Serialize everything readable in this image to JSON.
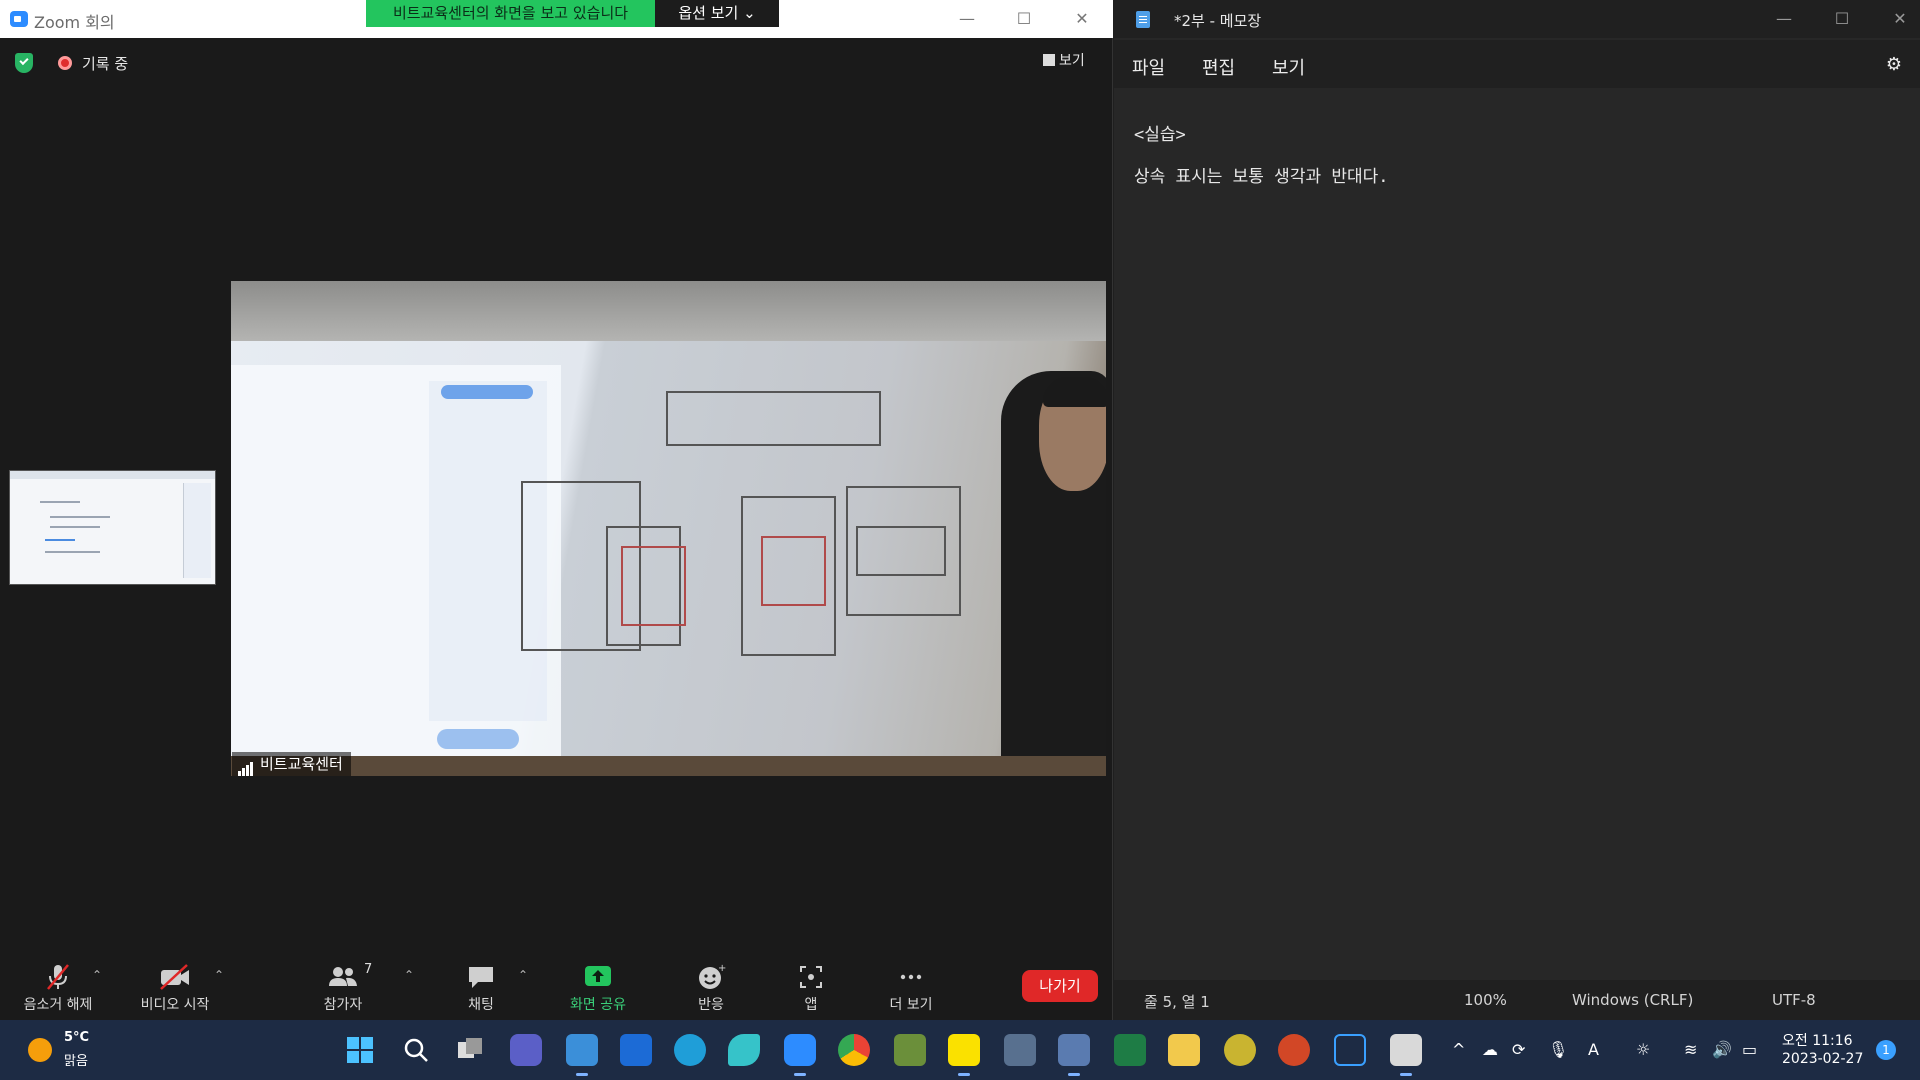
{
  "zoom": {
    "title": "Zoom 회의",
    "share_banner": "비트교육센터의 화면을 보고 있습니다",
    "options_label": "옵션 보기 ⌄",
    "recording_label": "기록 중",
    "view_label": "보기",
    "participant_name": "비트교육센터",
    "toolbar": {
      "audio": "음소거 해제",
      "video": "비디오 시작",
      "participants": "참가자",
      "participants_count": "7",
      "chat": "채팅",
      "share": "화면 공유",
      "reactions": "반응",
      "apps": "앱",
      "more": "더 보기",
      "leave": "나가기"
    }
  },
  "notepad": {
    "title": "*2부 - 메모장",
    "menu": [
      "파일",
      "편집",
      "보기"
    ],
    "lines": [
      "<실습>",
      "상속 표시는 보통 생각과 반대다."
    ],
    "status": {
      "position": "줄 5, 열 1",
      "zoom": "100%",
      "line_ending": "Windows (CRLF)",
      "encoding": "UTF-8"
    }
  },
  "taskbar": {
    "weather_temp": "5°C",
    "weather_desc": "맑음",
    "time": "오전 11:16",
    "date": "2023-02-27",
    "notification_count": "1",
    "apps": [
      "windows-start",
      "search",
      "task-view",
      "teams-chat",
      "notepad",
      "password-app",
      "edge",
      "bird-app",
      "zoom",
      "chrome",
      "minecraft",
      "kakaotalk",
      "calculator",
      "snipping-tool",
      "excel",
      "file-explorer",
      "whale",
      "powerpoint",
      "accessibility-app",
      "notepad-edit"
    ]
  },
  "colors": {
    "share_green": "#23c55e",
    "leave_red": "#e02828",
    "zoom_blue": "#2d8cff",
    "taskbar_bg": "#1d2b44"
  }
}
